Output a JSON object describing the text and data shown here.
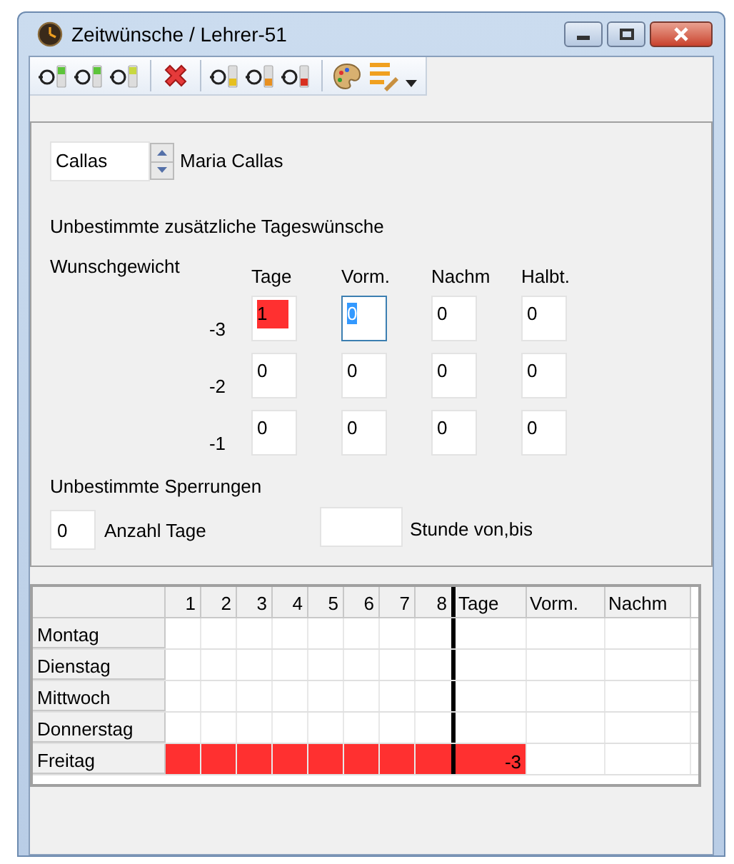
{
  "window": {
    "title": "Zeitwünsche / Lehrer-51"
  },
  "teacher": {
    "short_name": "Callas",
    "full_name": "Maria Callas"
  },
  "wishes": {
    "heading": "Unbestimmte zusätzliche Tageswünsche",
    "weight_label": "Wunschgewicht",
    "columns": [
      "Tage",
      "Vorm.",
      "Nachm",
      "Halbt."
    ],
    "rows": [
      {
        "weight": "-3",
        "cells": [
          {
            "value": "1",
            "marked": true,
            "focused": false
          },
          {
            "value": "0",
            "marked": false,
            "focused": true
          },
          {
            "value": "0",
            "marked": false,
            "focused": false
          },
          {
            "value": "0",
            "marked": false,
            "focused": false
          }
        ]
      },
      {
        "weight": "-2",
        "cells": [
          {
            "value": "0",
            "marked": false,
            "focused": false
          },
          {
            "value": "0",
            "marked": false,
            "focused": false
          },
          {
            "value": "0",
            "marked": false,
            "focused": false
          },
          {
            "value": "0",
            "marked": false,
            "focused": false
          }
        ]
      },
      {
        "weight": "-1",
        "cells": [
          {
            "value": "0",
            "marked": false,
            "focused": false
          },
          {
            "value": "0",
            "marked": false,
            "focused": false
          },
          {
            "value": "0",
            "marked": false,
            "focused": false
          },
          {
            "value": "0",
            "marked": false,
            "focused": false
          }
        ]
      }
    ]
  },
  "blocks": {
    "heading": "Unbestimmte Sperrungen",
    "days_value": "0",
    "days_label": "Anzahl Tage",
    "hours_label": "Stunde von,bis"
  },
  "grid": {
    "columns": [
      "1",
      "2",
      "3",
      "4",
      "5",
      "6",
      "7",
      "8",
      "Tage",
      "Vorm.",
      "Nachm"
    ],
    "rows": [
      {
        "day": "Montag",
        "cells": [
          {
            "marked": false
          },
          {
            "marked": false
          },
          {
            "marked": false
          },
          {
            "marked": false
          },
          {
            "marked": false
          },
          {
            "marked": false
          },
          {
            "marked": false
          },
          {
            "marked": false
          },
          {
            "marked": false
          },
          {
            "marked": false
          },
          {
            "marked": false
          }
        ]
      },
      {
        "day": "Dienstag",
        "cells": [
          {
            "marked": false
          },
          {
            "marked": false
          },
          {
            "marked": false
          },
          {
            "marked": false
          },
          {
            "marked": false
          },
          {
            "marked": false
          },
          {
            "marked": false
          },
          {
            "marked": false
          },
          {
            "marked": false
          },
          {
            "marked": false
          },
          {
            "marked": false
          }
        ]
      },
      {
        "day": "Mittwoch",
        "cells": [
          {
            "marked": false
          },
          {
            "marked": false
          },
          {
            "marked": false
          },
          {
            "marked": false
          },
          {
            "marked": false
          },
          {
            "marked": false
          },
          {
            "marked": false
          },
          {
            "marked": false
          },
          {
            "marked": false
          },
          {
            "marked": false
          },
          {
            "marked": false
          }
        ]
      },
      {
        "day": "Donnerstag",
        "cells": [
          {
            "marked": false
          },
          {
            "marked": false
          },
          {
            "marked": false
          },
          {
            "marked": false
          },
          {
            "marked": false
          },
          {
            "marked": false
          },
          {
            "marked": false
          },
          {
            "marked": false
          },
          {
            "marked": false
          },
          {
            "marked": false
          },
          {
            "marked": false
          }
        ]
      },
      {
        "day": "Freitag",
        "cells": [
          {
            "marked": true
          },
          {
            "marked": true
          },
          {
            "marked": true
          },
          {
            "marked": true
          },
          {
            "marked": true
          },
          {
            "marked": true
          },
          {
            "marked": true
          },
          {
            "marked": true
          },
          {
            "marked": true,
            "text": "-3"
          },
          {
            "marked": false
          },
          {
            "marked": false
          }
        ]
      }
    ]
  }
}
